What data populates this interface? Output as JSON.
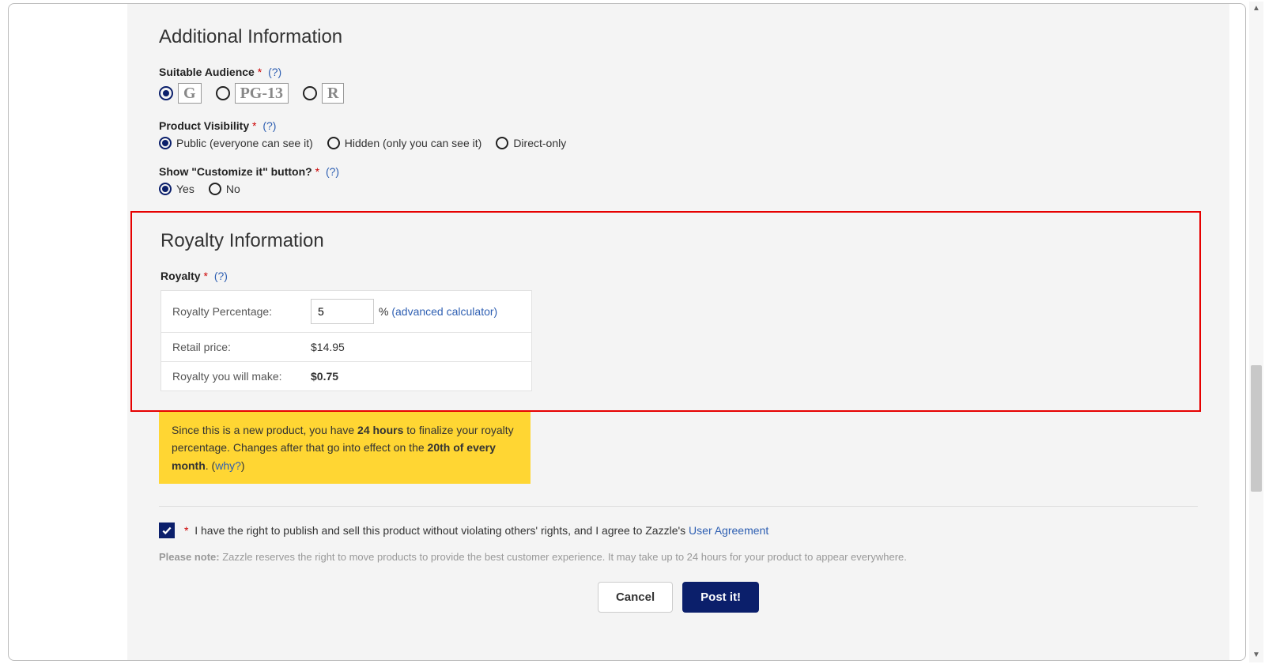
{
  "sections": {
    "additional": {
      "title": "Additional Information",
      "audience": {
        "label": "Suitable Audience",
        "help": "(?)",
        "options": [
          "G",
          "PG-13",
          "R"
        ],
        "selected_index": 0
      },
      "visibility": {
        "label": "Product Visibility",
        "help": "(?)",
        "options": [
          "Public (everyone can see it)",
          "Hidden (only you can see it)",
          "Direct-only"
        ],
        "selected_index": 0
      },
      "customize": {
        "label": "Show \"Customize it\" button?",
        "help": "(?)",
        "options": [
          "Yes",
          "No"
        ],
        "selected_index": 0
      }
    },
    "royalty": {
      "title": "Royalty Information",
      "label": "Royalty",
      "help": "(?)",
      "table": {
        "percentage_label": "Royalty Percentage:",
        "percentage_value": "5",
        "percent_symbol": "%",
        "calculator_link": "(advanced calculator)",
        "retail_label": "Retail price:",
        "retail_value": "$14.95",
        "earn_label": "Royalty you will make:",
        "earn_value": "$0.75"
      },
      "notice": {
        "pre1": "Since this is a new product, you have ",
        "bold1": "24 hours",
        "mid1": " to finalize your royalty percentage. Changes after that go into effect on the ",
        "bold2": "20th of every month",
        "post": ". (",
        "why": "why?",
        "close": ")"
      }
    },
    "agree": {
      "checked": true,
      "text_pre": "I have the right to publish and sell this product without violating others' rights, and I agree to Zazzle's ",
      "link_text": "User Agreement"
    },
    "please_note_label": "Please note:",
    "please_note_text": " Zazzle reserves the right to move products to provide the best customer experience. It may take up to 24 hours for your product to appear everywhere.",
    "buttons": {
      "cancel": "Cancel",
      "post": "Post it!"
    },
    "asterisk": "*"
  }
}
